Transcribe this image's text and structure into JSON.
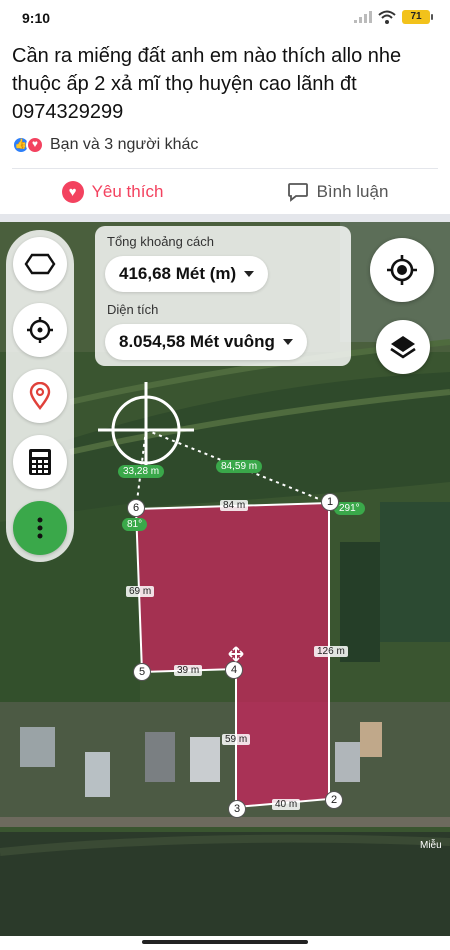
{
  "status": {
    "time": "9:10",
    "battery": "71"
  },
  "post": {
    "text": "Cần ra miếng đất  anh em nào thích allo nhe thuộc ấp 2 xả mĩ thọ  huyện cao lãnh đt 0974329299",
    "reactions_text": "Bạn và 3 người khác",
    "like_label": "Yêu thích",
    "comment_label": "Bình luận"
  },
  "map": {
    "distance_label": "Tổng khoảng cách",
    "distance_value": "416,68 Mét (m)",
    "area_label": "Diện tích",
    "area_value": "8.054,58 Mét vuông",
    "measure_tags": {
      "d1": "33,28 m",
      "d2": "84,59 m",
      "top": "84 m",
      "left": "69 m",
      "mid": "39 m",
      "right": "126 m",
      "inner": "59 m",
      "bottom": "40 m"
    },
    "angle_tags": {
      "a1": "291°",
      "a6": "81°"
    },
    "vertices": [
      "1",
      "2",
      "3",
      "4",
      "5",
      "6"
    ],
    "place_label": "Miễu"
  },
  "colors": {
    "like": "#f3425f",
    "accent_green": "#3aa84a",
    "area_fill": "#c8255c"
  },
  "icons": [
    "polygon-icon",
    "crosshair-icon",
    "location-pin-icon",
    "calculator-icon",
    "more-vertical-icon",
    "gps-locate-icon",
    "layers-icon",
    "move-icon",
    "like-icon",
    "love-icon",
    "heart-icon",
    "comment-icon",
    "wifi-icon",
    "signal-icon"
  ]
}
